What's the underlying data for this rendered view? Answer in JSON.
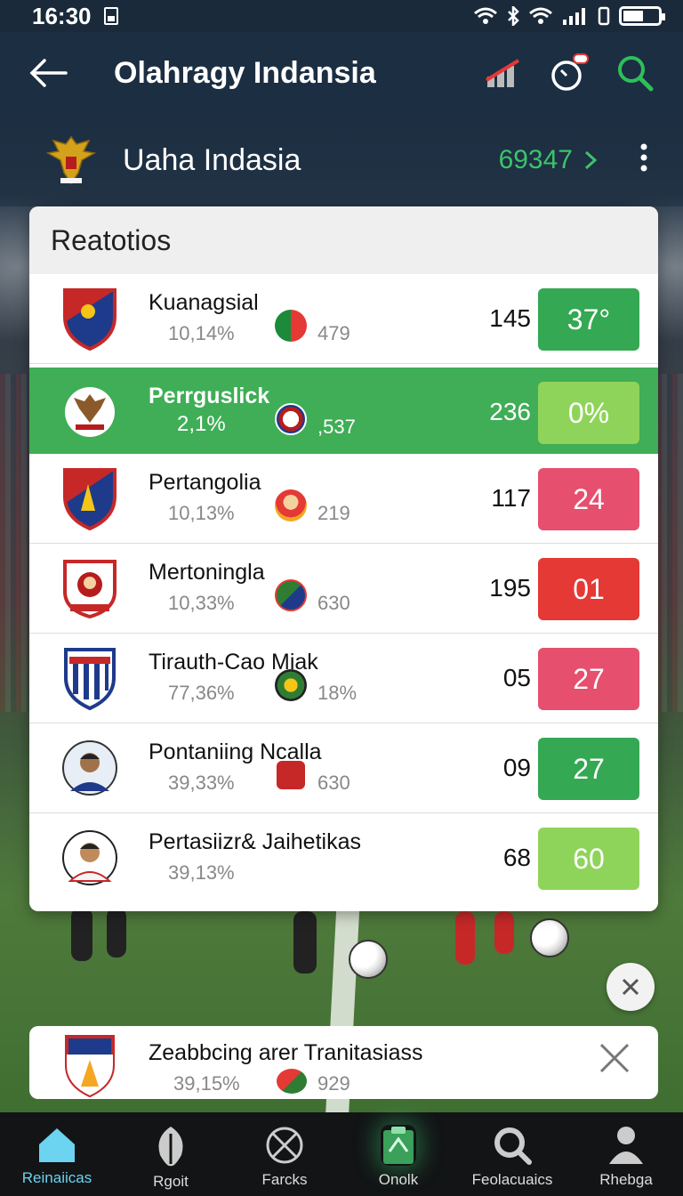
{
  "status_bar": {
    "time": "16:30"
  },
  "app_bar": {
    "title": "Olahragy Indansia"
  },
  "subheader": {
    "name": "Uaha Indasia",
    "score": "69347"
  },
  "card": {
    "title": "Reatotios",
    "rows": [
      {
        "team": "Kuanagsial",
        "pct": "10,14%",
        "mini_val": "479",
        "num": "145",
        "badge": "37°",
        "badge_color": "#34a853"
      },
      {
        "team": "Perrguslick",
        "pct": "2,1%",
        "mini_val": ",537",
        "num": "236",
        "badge": "0%",
        "badge_color": "#8fd45a"
      },
      {
        "team": "Pertangolia",
        "pct": "10,13%",
        "mini_val": "219",
        "num": "117",
        "badge": "24",
        "badge_color": "#e64f6e"
      },
      {
        "team": "Mertoningla",
        "pct": "10,33%",
        "mini_val": "630",
        "num": "195",
        "badge": "01",
        "badge_color": "#e53935"
      },
      {
        "team": "Tirauth-Cao Miak",
        "pct": "77,36%",
        "mini_val": "18%",
        "num": "05",
        "badge": "27",
        "badge_color": "#e64f6e"
      },
      {
        "team": "Pontaniing Ncalla",
        "pct": "39,33%",
        "mini_val": "630",
        "num": "09",
        "badge": "27",
        "badge_color": "#34a853"
      },
      {
        "team": "Pertasiizr& Jaihetikas",
        "pct": "39,13%",
        "mini_val": "",
        "num": "68",
        "badge": "60",
        "badge_color": "#8fd45a"
      }
    ]
  },
  "notification": {
    "team": "Zeabbcing arer Tranitasiass",
    "pct": "39,15%",
    "mini_val": "929"
  },
  "bottom_nav": [
    {
      "label": "Reinaiicas",
      "icon": "home-icon"
    },
    {
      "label": "Rgoit",
      "icon": "leaf-icon"
    },
    {
      "label": "Farcks",
      "icon": "ball-icon"
    },
    {
      "label": "Onolk",
      "icon": "clipboard-icon"
    },
    {
      "label": "Feolacuaics",
      "icon": "search-icon"
    },
    {
      "label": "Rhebga",
      "icon": "person-icon"
    }
  ],
  "colors": {
    "accent_green": "#3cc36a",
    "highlight_row": "#3fae56",
    "app_bar": "#1c2e42",
    "active_nav": "#6cd3f0"
  }
}
